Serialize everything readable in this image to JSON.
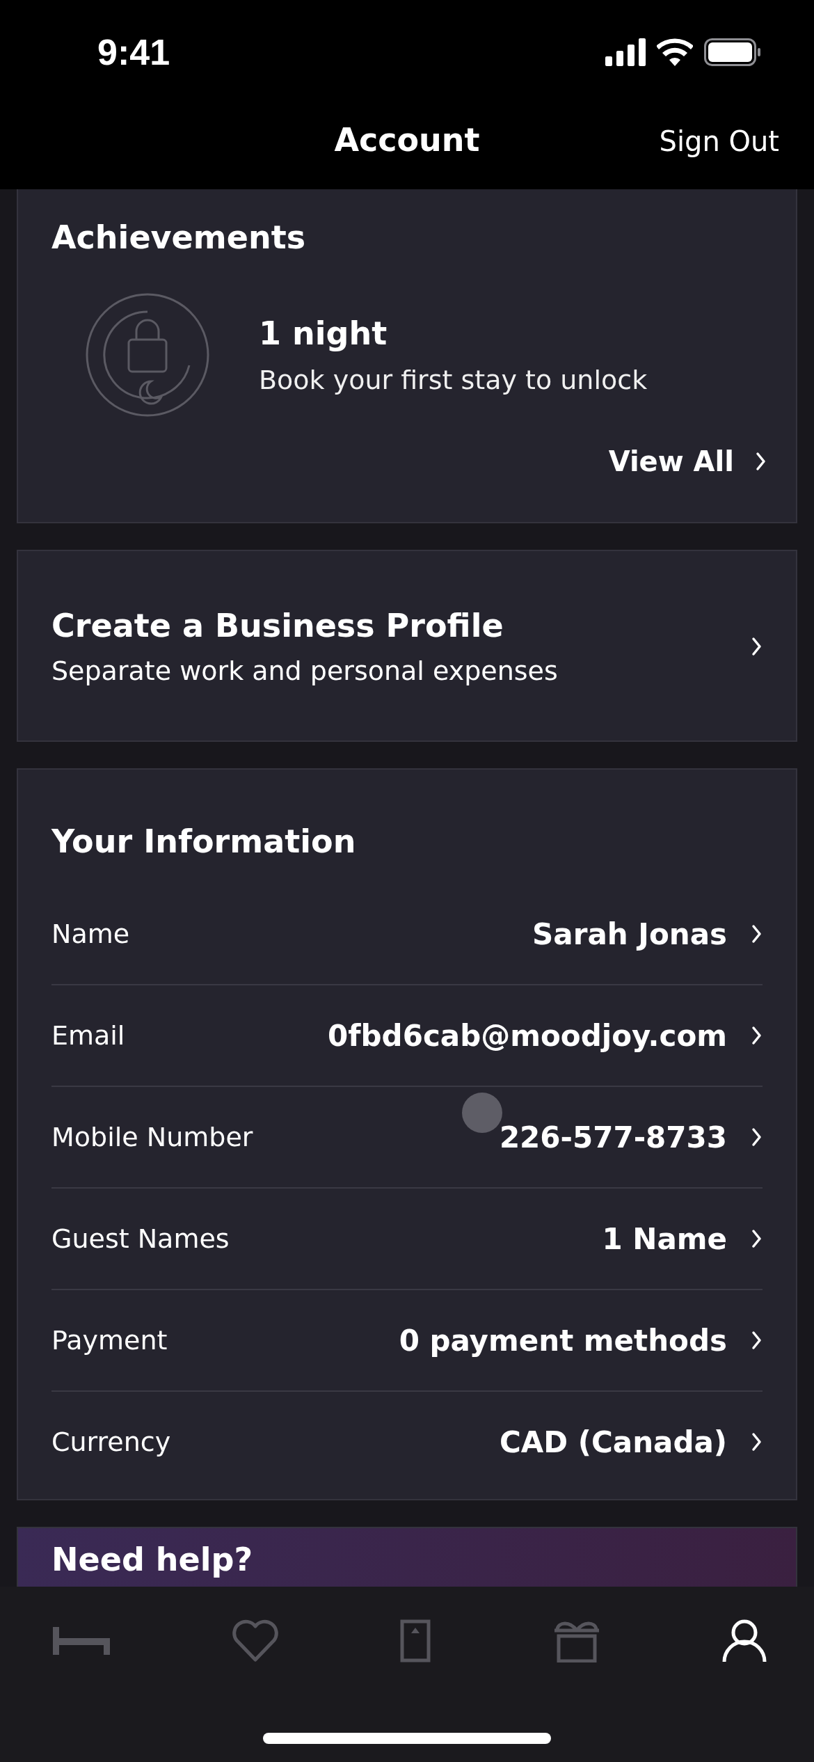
{
  "status_bar": {
    "time": "9:41"
  },
  "nav": {
    "title": "Account",
    "action": "Sign Out"
  },
  "achievements": {
    "title": "Achievements",
    "badge_title": "1 night",
    "badge_text": "Book your first stay to unlock",
    "locked": true,
    "link": "View All"
  },
  "business": {
    "title": "Create a Business Profile",
    "subtitle": "Separate work and personal expenses"
  },
  "info": {
    "title": "Your Information",
    "rows": [
      {
        "label": "Name",
        "value": "Sarah Jonas"
      },
      {
        "label": "Email",
        "value": "0fbd6cab@moodjoy.com"
      },
      {
        "label": "Mobile Number",
        "value": "226-577-8733"
      },
      {
        "label": "Guest Names",
        "value": "1 Name"
      },
      {
        "label": "Payment",
        "value": "0 payment methods"
      },
      {
        "label": "Currency",
        "value": "CAD (Canada)"
      }
    ]
  },
  "help": {
    "title": "Need help?"
  },
  "tab_bar": [
    {
      "kind": "bed",
      "selected": false
    },
    {
      "kind": "heart",
      "selected": false
    },
    {
      "kind": "door",
      "selected": false
    },
    {
      "kind": "gift",
      "selected": false
    },
    {
      "kind": "person",
      "selected": true
    }
  ]
}
